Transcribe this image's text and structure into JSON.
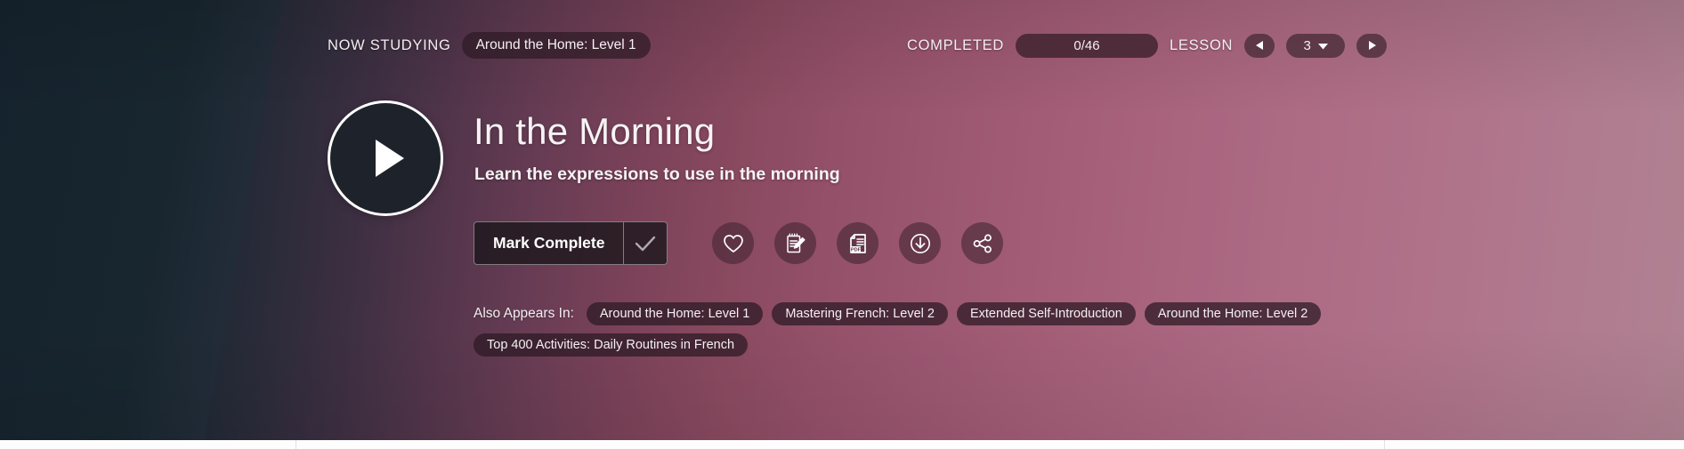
{
  "header": {
    "now_studying_label": "NOW STUDYING",
    "course_name": "Around the Home: Level 1",
    "completed_label": "COMPLETED",
    "completed_value": "0/46",
    "lesson_label": "LESSON",
    "lesson_number": "3",
    "prev_icon": "triangle-left-icon",
    "next_icon": "triangle-right-icon",
    "dropdown_icon": "chevron-down-icon"
  },
  "lesson": {
    "play_icon": "play-icon",
    "title": "In the Morning",
    "subtitle": "Learn the expressions to use in the morning"
  },
  "actions": {
    "mark_complete_label": "Mark Complete",
    "check_icon": "checkmark-icon",
    "icons": [
      {
        "name": "heart-icon",
        "title": "Favorite"
      },
      {
        "name": "notepad-pencil-icon",
        "title": "Notes"
      },
      {
        "name": "pdf-document-icon",
        "title": "PDF"
      },
      {
        "name": "download-icon",
        "title": "Download"
      },
      {
        "name": "share-icon",
        "title": "Share"
      }
    ]
  },
  "also_appears_in": {
    "label": "Also Appears In:",
    "tags": [
      "Around the Home: Level 1",
      "Mastering French: Level 2",
      "Extended Self-Introduction",
      "Around the Home: Level 2",
      "Top 400 Activities: Daily Routines in French"
    ]
  },
  "colors": {
    "hero_left": "#14222d",
    "hero_right": "#b08292",
    "pill_dark": "#2c1a24",
    "play_button_bg": "#1e232b",
    "text_light": "#f4f0f2"
  }
}
